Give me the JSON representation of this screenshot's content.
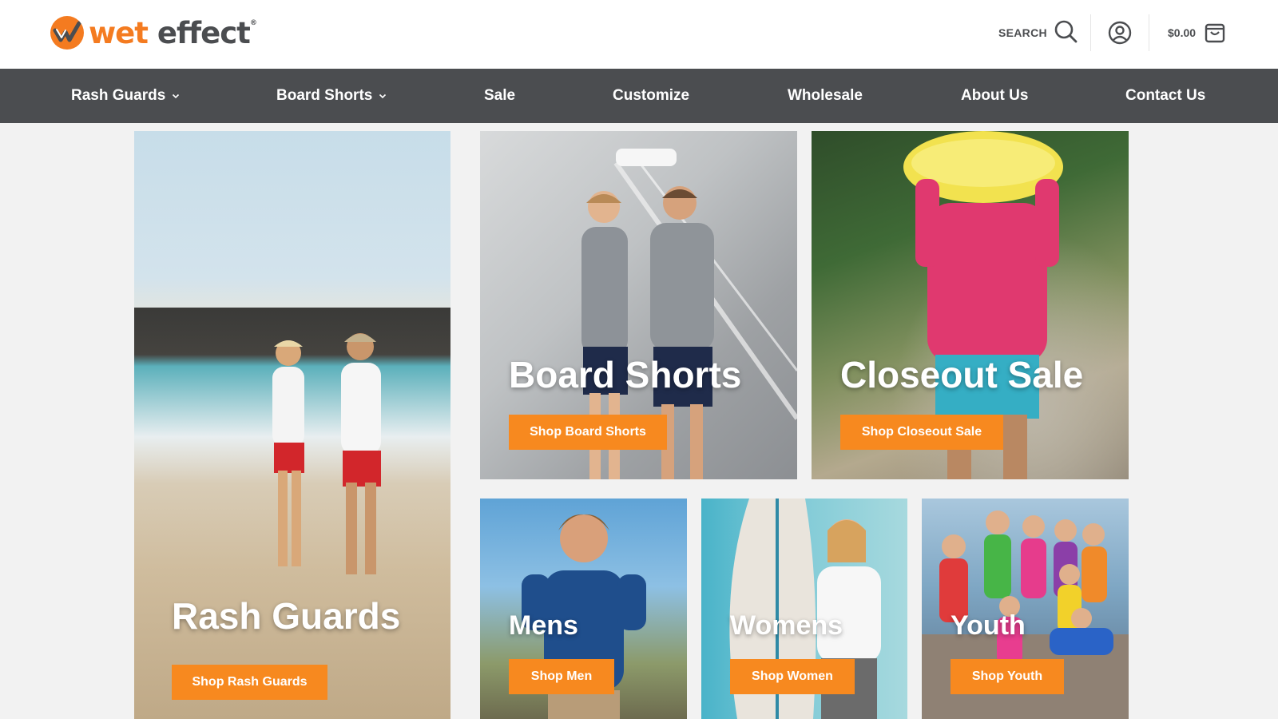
{
  "brand": {
    "name_part1": "wet",
    "name_part2": "effect",
    "registered": "®",
    "accent_color": "#f47b20",
    "dark_color": "#4b4d50"
  },
  "header": {
    "search_label": "SEARCH",
    "search_icon": "search-icon",
    "account_icon": "user-circle-icon",
    "cart_total": "$0.00",
    "cart_icon": "shopping-bag-icon"
  },
  "nav": {
    "items": [
      {
        "label": "Rash Guards",
        "has_dropdown": true
      },
      {
        "label": "Board Shorts",
        "has_dropdown": true
      },
      {
        "label": "Sale",
        "has_dropdown": false
      },
      {
        "label": "Customize",
        "has_dropdown": false
      },
      {
        "label": "Wholesale",
        "has_dropdown": false
      },
      {
        "label": "About Us",
        "has_dropdown": false
      },
      {
        "label": "Contact Us",
        "has_dropdown": false
      }
    ]
  },
  "tiles": {
    "rash_guards": {
      "title": "Rash Guards",
      "button": "Shop Rash Guards"
    },
    "board_shorts": {
      "title": "Board Shorts",
      "button": "Shop Board Shorts"
    },
    "closeout": {
      "title": "Closeout Sale",
      "button": "Shop Closeout Sale"
    },
    "mens": {
      "title": "Mens",
      "button": "Shop Men"
    },
    "womens": {
      "title": "Womens",
      "button": "Shop Women"
    },
    "youth": {
      "title": "Youth",
      "button": "Shop Youth"
    }
  },
  "colors": {
    "nav_bg": "#4b4d50",
    "button_bg": "#f7891f",
    "page_bg": "#f2f2f2"
  }
}
